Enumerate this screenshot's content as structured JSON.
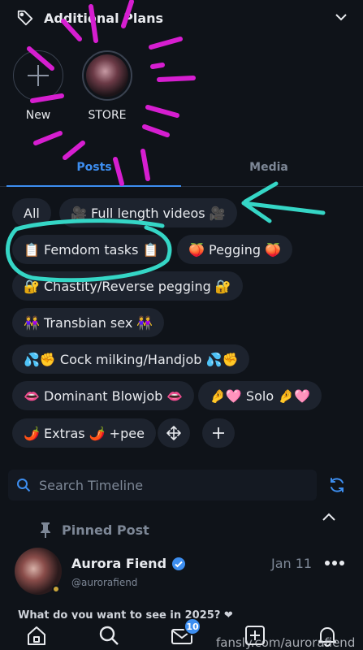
{
  "plans_header": {
    "title": "Additional Plans"
  },
  "stories": [
    {
      "label": "New",
      "icon": "plus-icon"
    },
    {
      "label": "STORE"
    }
  ],
  "tabs": [
    {
      "label": "Posts",
      "active": true
    },
    {
      "label": "Media",
      "active": false
    }
  ],
  "filters": [
    {
      "label": "All"
    },
    {
      "label": "🎥 Full length videos 🎥"
    },
    {
      "label": "📋 Femdom tasks 📋"
    },
    {
      "label": "🍑 Pegging 🍑"
    },
    {
      "label": "🔐 Chastity/Reverse pegging 🔐"
    },
    {
      "label": "👭 Transbian sex 👭"
    },
    {
      "label": "💦✊ Cock milking/Handjob 💦✊"
    },
    {
      "label": "👄 Dominant Blowjob 👄"
    },
    {
      "label": "🤌🩷 Solo 🤌🩷"
    },
    {
      "label": "🌶️ Extras 🌶️ +pee"
    }
  ],
  "filter_actions": [
    {
      "icon": "move-arrows-icon"
    },
    {
      "icon": "plus-icon"
    }
  ],
  "search": {
    "placeholder": "Search Timeline"
  },
  "pinned_label": "Pinned Post",
  "post": {
    "author": "Aurora Fiend",
    "handle": "@aurorafiend",
    "date": "Jan 11",
    "teaser": "What do you want to see in 2025? ❤"
  },
  "nav": {
    "messages_badge": "10"
  },
  "watermark": "fansly.com/aurorafiend",
  "colors": {
    "background": "#0f1319",
    "accent": "#3d8ef0",
    "chip": "#1d232e",
    "annotation_magenta": "#d61ed0",
    "annotation_cyan": "#35d6c6"
  }
}
